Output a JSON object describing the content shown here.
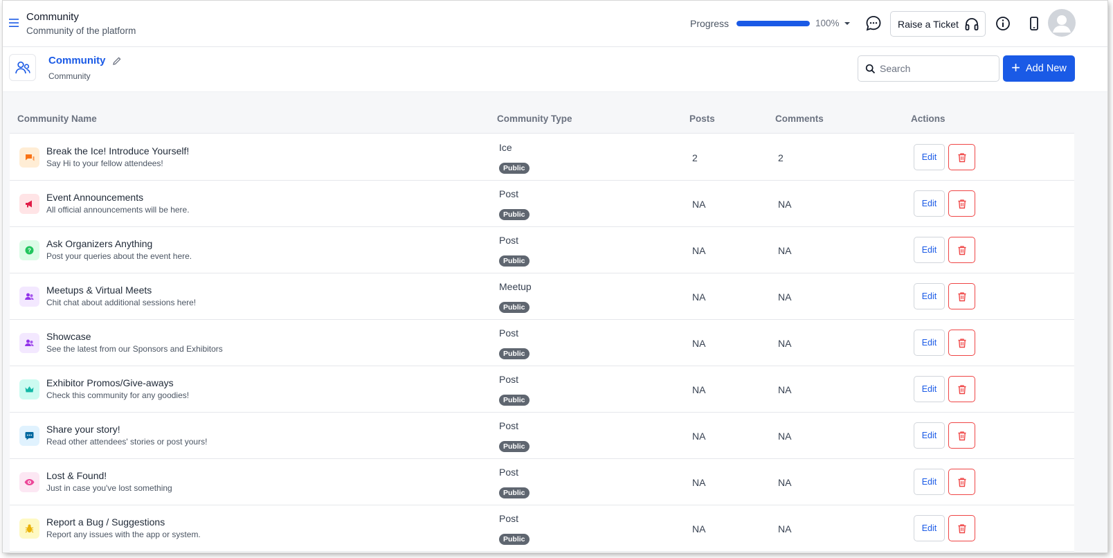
{
  "header": {
    "title": "Community",
    "subtitle": "Community of the platform",
    "progress_label": "Progress",
    "progress_value": 100,
    "progress_text": "100%",
    "ticket_label": "Raise a Ticket"
  },
  "page": {
    "title": "Community",
    "subtitle": "Community",
    "search_placeholder": "Search",
    "add_label": "Add New"
  },
  "columns": {
    "name": "Community Name",
    "type": "Community Type",
    "posts": "Posts",
    "comments": "Comments",
    "actions": "Actions"
  },
  "edit_label": "Edit",
  "rows": [
    {
      "name": "Break the Ice! Introduce Yourself!",
      "desc": "Say Hi to your fellow attendees!",
      "type": "Ice",
      "badge": "Public",
      "posts": "2",
      "comments": "2",
      "icon": "chat-bubbles-icon",
      "icon_color": "#f97316",
      "icon_bg": "#ffedd5"
    },
    {
      "name": "Event Announcements",
      "desc": "All official announcements will be here.",
      "type": "Post",
      "badge": "Public",
      "posts": "NA",
      "comments": "NA",
      "icon": "megaphone-icon",
      "icon_color": "#e11d48",
      "icon_bg": "#ffe4e6"
    },
    {
      "name": "Ask Organizers Anything",
      "desc": "Post your queries about the event here.",
      "type": "Post",
      "badge": "Public",
      "posts": "NA",
      "comments": "NA",
      "icon": "question-icon",
      "icon_color": "#22c55e",
      "icon_bg": "#dcfce7"
    },
    {
      "name": "Meetups & Virtual Meets",
      "desc": "Chit chat about additional sessions here!",
      "type": "Meetup",
      "badge": "Public",
      "posts": "NA",
      "comments": "NA",
      "icon": "people-icon",
      "icon_color": "#9333ea",
      "icon_bg": "#f3e8ff"
    },
    {
      "name": "Showcase",
      "desc": "See the latest from our Sponsors and Exhibitors",
      "type": "Post",
      "badge": "Public",
      "posts": "NA",
      "comments": "NA",
      "icon": "people-icon",
      "icon_color": "#9333ea",
      "icon_bg": "#f3e8ff"
    },
    {
      "name": "Exhibitor Promos/Give-aways",
      "desc": "Check this community for any goodies!",
      "type": "Post",
      "badge": "Public",
      "posts": "NA",
      "comments": "NA",
      "icon": "crown-icon",
      "icon_color": "#14b8a6",
      "icon_bg": "#ccfbf1"
    },
    {
      "name": "Share your story!",
      "desc": "Read other attendees' stories or post yours!",
      "type": "Post",
      "badge": "Public",
      "posts": "NA",
      "comments": "NA",
      "icon": "message-icon",
      "icon_color": "#0369a1",
      "icon_bg": "#e0f2fe"
    },
    {
      "name": "Lost & Found!",
      "desc": "Just in case you've lost something",
      "type": "Post",
      "badge": "Public",
      "posts": "NA",
      "comments": "NA",
      "icon": "eye-icon",
      "icon_color": "#ec4899",
      "icon_bg": "#fce7f3"
    },
    {
      "name": "Report a Bug / Suggestions",
      "desc": "Report any issues with the app or system.",
      "type": "Post",
      "badge": "Public",
      "posts": "NA",
      "comments": "NA",
      "icon": "bug-icon",
      "icon_color": "#eab308",
      "icon_bg": "#fef9c3"
    }
  ],
  "colors": {
    "accent": "#1a5ae6",
    "danger": "#ef4444",
    "badge": "#5f6670"
  }
}
